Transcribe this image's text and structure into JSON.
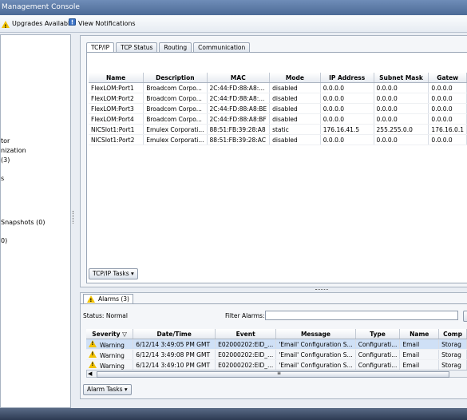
{
  "window": {
    "title": "Management Console"
  },
  "toolbar": {
    "upgrades_label": "Upgrades Available",
    "notifications_label": "View Notifications"
  },
  "sidebar": {
    "items": [
      {
        "label": "tor"
      },
      {
        "label": "nization"
      },
      {
        "label": "(3)"
      },
      {
        "label": "s"
      },
      {
        "label": "Snapshots (0)"
      },
      {
        "label": "0)"
      }
    ]
  },
  "tabs": [
    {
      "label": "TCP/IP",
      "active": true
    },
    {
      "label": "TCP Status",
      "active": false
    },
    {
      "label": "Routing",
      "active": false
    },
    {
      "label": "Communication",
      "active": false
    }
  ],
  "tcpip": {
    "columns": [
      "Name",
      "Description",
      "MAC",
      "Mode",
      "IP Address",
      "Subnet Mask",
      "Gatew"
    ],
    "rows": [
      [
        "FlexLOM:Port1",
        "Broadcom Corpo...",
        "2C:44:FD:88:A8:...",
        "disabled",
        "0.0.0.0",
        "0.0.0.0",
        "0.0.0.0"
      ],
      [
        "FlexLOM:Port2",
        "Broadcom Corpo...",
        "2C:44:FD:88:A8:...",
        "disabled",
        "0.0.0.0",
        "0.0.0.0",
        "0.0.0.0"
      ],
      [
        "FlexLOM:Port3",
        "Broadcom Corpo...",
        "2C:44:FD:88:A8:BE",
        "disabled",
        "0.0.0.0",
        "0.0.0.0",
        "0.0.0.0"
      ],
      [
        "FlexLOM:Port4",
        "Broadcom Corpo...",
        "2C:44:FD:88:A8:BF",
        "disabled",
        "0.0.0.0",
        "0.0.0.0",
        "0.0.0.0"
      ],
      [
        "NICSlot1:Port1",
        "Emulex Corporati...",
        "88:51:FB:39:28:A8",
        "static",
        "176.16.41.5",
        "255.255.0.0",
        "176.16.0.1"
      ],
      [
        "NICSlot1:Port2",
        "Emulex Corporati...",
        "88:51:FB:39:28:AC",
        "disabled",
        "0.0.0.0",
        "0.0.0.0",
        "0.0.0.0"
      ]
    ],
    "tasks_label": "TCP/IP Tasks ▾"
  },
  "alarms": {
    "tab_label": "Alarms (3)",
    "status_label": "Status:",
    "status_value": "Normal",
    "filter_label": "Filter Alarms:",
    "filter_value": "",
    "columns": [
      "Severity",
      "Date/Time",
      "Event",
      "Message",
      "Type",
      "Name",
      "Comp"
    ],
    "rows": [
      [
        "Warning",
        "6/12/14 3:49:05 PM GMT",
        "E02000202:EID_...",
        "'Email' Configuration S...",
        "Configurati...",
        "Email",
        "Storag"
      ],
      [
        "Warning",
        "6/12/14 3:49:08 PM GMT",
        "E02000202:EID_...",
        "'Email' Configuration S...",
        "Configurati...",
        "Email",
        "Storag"
      ],
      [
        "Warning",
        "6/12/14 3:49:10 PM GMT",
        "E02000202:EID_...",
        "'Email' Configuration S...",
        "Configurati...",
        "Email",
        "Storag"
      ]
    ],
    "tasks_label": "Alarm Tasks ▾"
  }
}
